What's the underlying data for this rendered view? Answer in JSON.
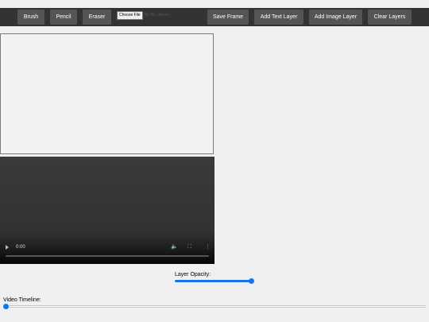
{
  "toolbar": {
    "brush_label": "Brush",
    "pencil_label": "Pencil",
    "eraser_label": "Eraser",
    "choose_file_label": "Choose File",
    "no_file_text": "No file chosen",
    "save_frame_label": "Save Frame",
    "add_text_layer_label": "Add Text Layer",
    "add_image_layer_label": "Add Image Layer",
    "clear_layers_label": "Clear Layers"
  },
  "video": {
    "time": "0:00",
    "progress": 0,
    "play_icon": "play-icon",
    "volume_icon": "volume-icon",
    "fullscreen_icon": "fullscreen-icon",
    "more_icon": "more-options-icon"
  },
  "layer_opacity": {
    "label": "Layer Opacity:",
    "value": 1.0
  },
  "video_timeline": {
    "label": "Video Timeline:",
    "value": 0
  },
  "colors": {
    "toolbar_bg": "#333333",
    "button_bg": "#555555",
    "accent": "#1a73e8"
  }
}
